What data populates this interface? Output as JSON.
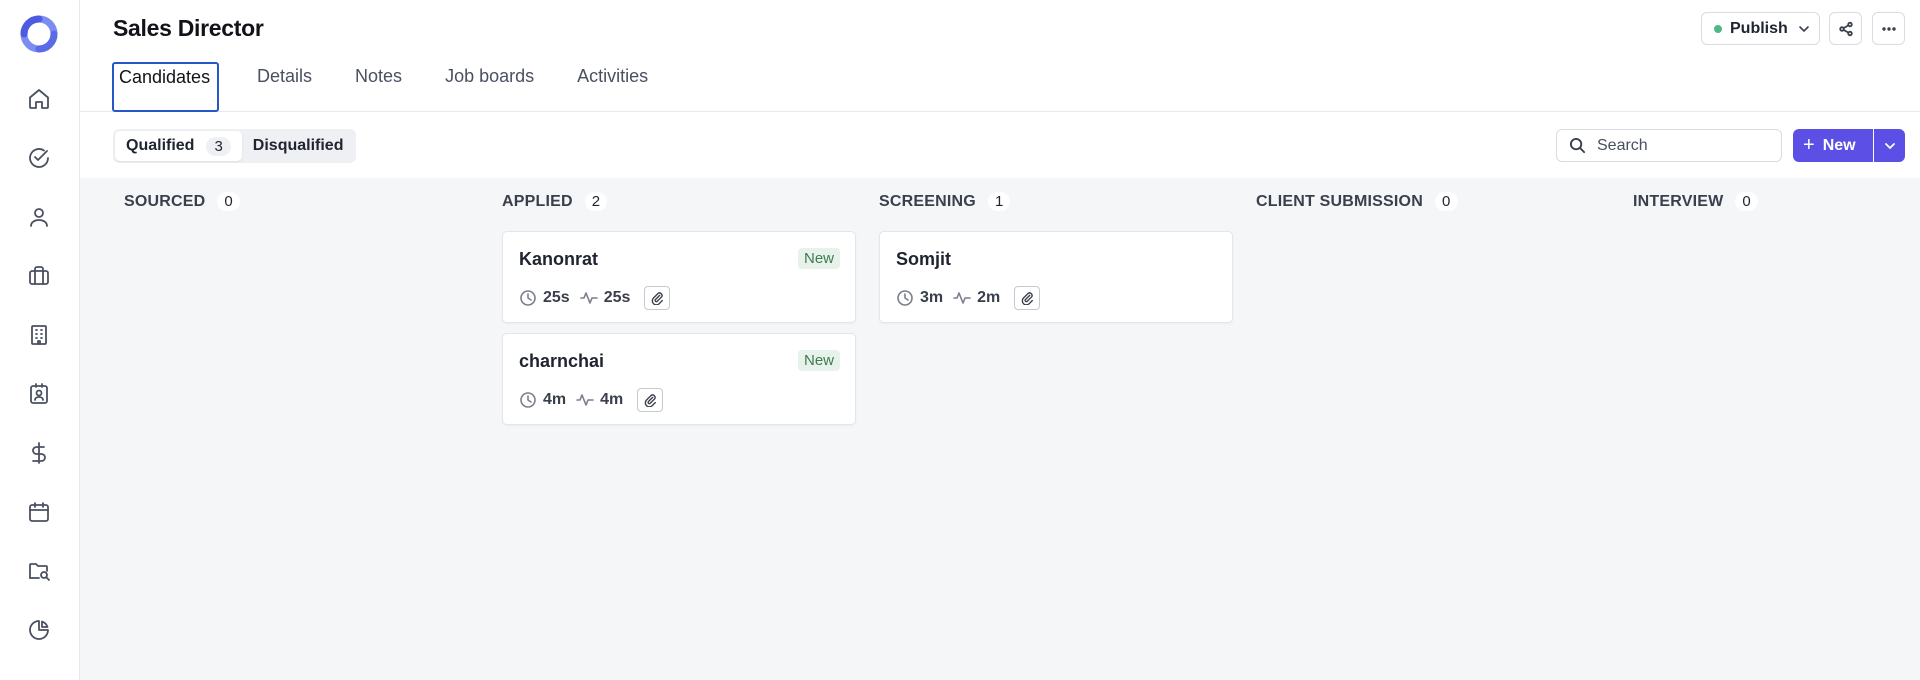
{
  "header": {
    "title": "Sales Director",
    "tabs": [
      {
        "label": "Candidates"
      },
      {
        "label": "Details"
      },
      {
        "label": "Notes"
      },
      {
        "label": "Job boards"
      },
      {
        "label": "Activities"
      }
    ],
    "publish_label": "Publish",
    "publish_status_color": "#4fb885",
    "share_icon": "share-icon",
    "more_icon": "more-icon",
    "avatar_add": "+"
  },
  "sidebar": {
    "items": [
      {
        "icon": "home-icon"
      },
      {
        "icon": "check-circle-icon"
      },
      {
        "icon": "user-icon"
      },
      {
        "icon": "briefcase-icon"
      },
      {
        "icon": "building-icon"
      },
      {
        "icon": "contact-badge-icon"
      },
      {
        "icon": "dollar-icon"
      },
      {
        "icon": "calendar-icon"
      },
      {
        "icon": "folder-search-icon"
      },
      {
        "icon": "pie-chart-icon"
      }
    ]
  },
  "filters": {
    "qualified_label": "Qualified",
    "qualified_count": "3",
    "disqualified_label": "Disqualified",
    "search_placeholder": "Search",
    "new_label": "New"
  },
  "board": {
    "columns": [
      {
        "name": "SOURCED",
        "count": "0",
        "cards": []
      },
      {
        "name": "APPLIED",
        "count": "2",
        "cards": [
          {
            "name": "Kanonrat",
            "badge": "New",
            "time": "25s",
            "activity": "25s"
          },
          {
            "name": "charnchai",
            "badge": "New",
            "time": "4m",
            "activity": "4m"
          }
        ]
      },
      {
        "name": "SCREENING",
        "count": "1",
        "cards": [
          {
            "name": "Somjit",
            "badge": "",
            "time": "3m",
            "activity": "2m"
          }
        ]
      },
      {
        "name": "CLIENT SUBMISSION",
        "count": "0",
        "cards": []
      },
      {
        "name": "INTERVIEW",
        "count": "0",
        "cards": []
      }
    ]
  },
  "colors": {
    "accent": "#5b4fe6",
    "active_tab_border": "#2557c9",
    "badge_bg": "#e7f2ea",
    "badge_text": "#3e7a52"
  }
}
